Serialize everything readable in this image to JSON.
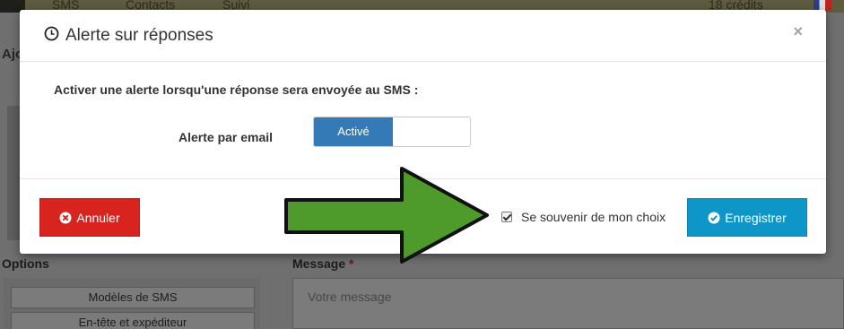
{
  "background": {
    "nav_sms": "SMS",
    "nav_contacts": "Contacts",
    "nav_suivi": "Suivi",
    "credits": "18 crédits",
    "page_heading": "Ajo",
    "options_label": "Options",
    "message_label": "Message",
    "message_required": "*",
    "message_placeholder": "Votre message",
    "options_buttons": [
      "Modèles de SMS",
      "En-tête et expéditeur"
    ]
  },
  "modal": {
    "title": "Alerte sur réponses",
    "close": "×",
    "question": "Activer une alerte lorsqu'une réponse sera envoyée au SMS :",
    "email_label": "Alerte par email",
    "toggle_state": "Activé",
    "remember_label": "Se souvenir de mon choix",
    "remember_checked": true,
    "cancel_label": "Annuler",
    "save_label": "Enregistrer"
  },
  "colors": {
    "cancel": "#d9231f",
    "save": "#0f96c8",
    "toggle_on": "#337ab7",
    "arrow": "#4e9a2a"
  }
}
